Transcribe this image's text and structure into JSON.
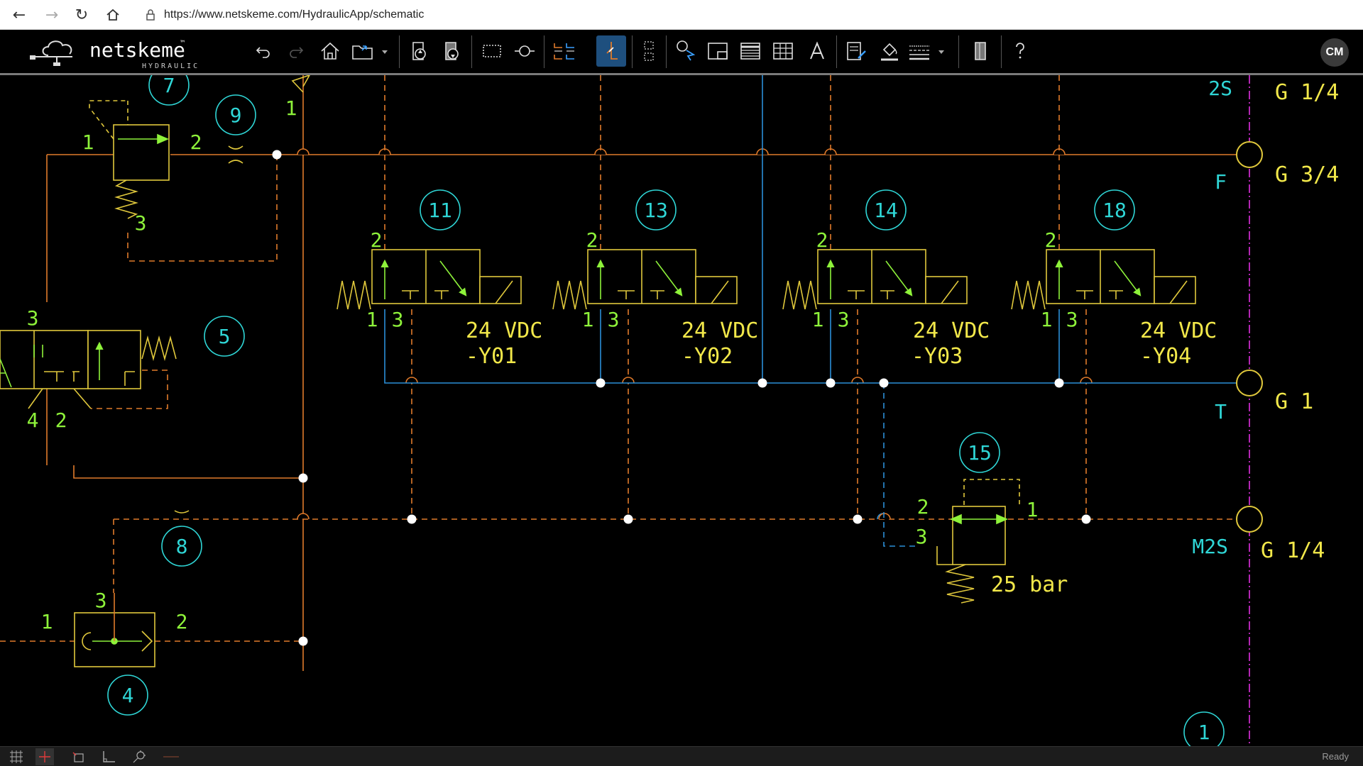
{
  "browser": {
    "url": "https://www.netskeme.com/HydraulicApp/schematic"
  },
  "app": {
    "brand": "netskeme",
    "brand_tm": "™",
    "sub_brand": "HYDRAULIC",
    "user_initials": "CM"
  },
  "status": {
    "text": "Ready"
  },
  "schematic": {
    "tags": {
      "t7": "7",
      "t9": "9",
      "t5": "5",
      "t8": "8",
      "t4": "4",
      "t11": "11",
      "t13": "13",
      "t14": "14",
      "t18": "18",
      "t15": "15",
      "t1": "1"
    },
    "ports": {
      "p_1": "1",
      "p_2": "2",
      "p_3": "3",
      "p_4": "4"
    },
    "voltage": "24 VDC",
    "coils": {
      "y01": "-Y01",
      "y02": "-Y02",
      "y03": "-Y03",
      "y04": "-Y04"
    },
    "relief_setting": "25 bar",
    "line_labels": {
      "ls": "2S",
      "f": "F",
      "t": "T",
      "m2s": "M2S"
    },
    "port_sizes": {
      "ls": "G 1/4",
      "f": "G 3/4",
      "t": "G 1",
      "m2s": "G 1/4"
    }
  },
  "colors": {
    "pressure": "#e07a2a",
    "tank": "#2b8fd8",
    "component": "#c8c83c",
    "port_label": "#8ef23a",
    "tag": "#2fd6d6",
    "manifold": "#e030e0",
    "text_yellow": "#f2e84a"
  }
}
